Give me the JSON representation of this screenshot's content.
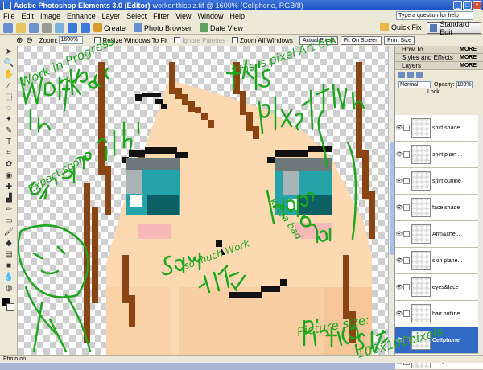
{
  "window": {
    "title_main": "Adobe Photoshop Elements 3.0 (Editor)",
    "title_file": "workonthispiz.tif @ 1600% (Cellphone, RGB/8)"
  },
  "menubar": {
    "items": [
      "File",
      "Edit",
      "Image",
      "Enhance",
      "Layer",
      "Select",
      "Filter",
      "View",
      "Window",
      "Help"
    ],
    "help_search": "Type a question for help"
  },
  "toolbar": {
    "create": "Create",
    "photo_browser": "Photo Browser",
    "date_view": "Date View",
    "quick_fix": "Quick Fix",
    "standard_edit": "Standard Edit"
  },
  "options": {
    "zoom_label": "Zoom:",
    "zoom_value": "1600%",
    "resize_windows": "Resize Windows To Fit",
    "ignore_palettes": "Ignore Palettes",
    "zoom_all_windows": "Zoom All Windows",
    "actual_pixels": "Actual Pixels",
    "fit_on_screen": "Fit On Screen",
    "print_size": "Print Size"
  },
  "palette": {
    "how_to": "How To",
    "styles_effects": "Styles and Effects",
    "layers": "Layers",
    "more": "MORE",
    "blend_mode": "Normal",
    "opacity_label": "Opacity:",
    "opacity_value": "100%",
    "lock_label": "Lock:",
    "layers_list": [
      {
        "name": "shirt shade",
        "selected": false
      },
      {
        "name": "shirt plain ...",
        "selected": false
      },
      {
        "name": "shirt outline",
        "selected": false
      },
      {
        "name": "face shade",
        "selected": false
      },
      {
        "name": "Arm&che...",
        "selected": false
      },
      {
        "name": "skin plane...",
        "selected": false
      },
      {
        "name": "eyes&face",
        "selected": false
      },
      {
        "name": "hair outline",
        "selected": false
      },
      {
        "name": "Cellphone",
        "selected": true
      },
      {
        "name": "body&cel...",
        "selected": false
      }
    ]
  },
  "statusbar": {
    "text": "Photo on"
  },
  "annotations": {
    "work_in_progress": "Work in Progress",
    "expect_soon": "Expect soon!",
    "this_is_pixel_art": "This is pixel Art btw",
    "kinda_bad": "kinda bad",
    "so_much_work": "so much Work",
    "picture_size": "Picture size:",
    "picture_dims": "100x100pixels"
  },
  "colors": {
    "hair": "#8b4513",
    "skin": "#fcd9b0",
    "skin_shade": "#f4c698",
    "blush": "#f7b8b8",
    "eye_teal": "#24a3a8",
    "eye_dark": "#0d5f66",
    "scribble": "#1fa61f"
  }
}
